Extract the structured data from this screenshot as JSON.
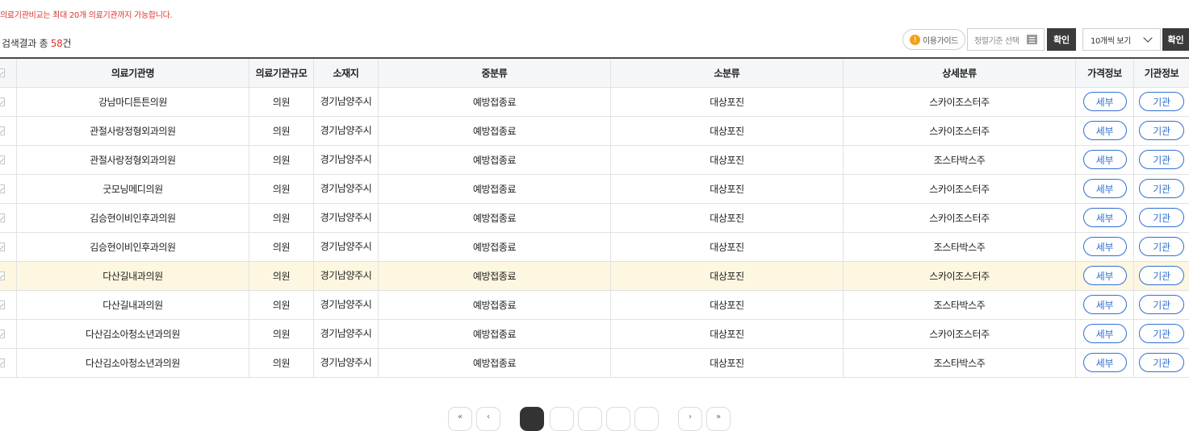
{
  "notice": "의료기관비교는 최대 20개 의료기관까지 가능합니다.",
  "summary": {
    "prefix": "검색결과 총 ",
    "count": "58",
    "suffix": "건"
  },
  "toolbar": {
    "guide_icon": "!",
    "guide_label": "이용가이드",
    "sort_placeholder": "정렬기준 선택",
    "confirm_label": "확인",
    "per_page_value": "10개씩 보기",
    "confirm2_label": "확인"
  },
  "table": {
    "headers": {
      "name": "의료기관명",
      "scale": "의료기관규모",
      "location": "소재지",
      "mid_category": "중분류",
      "sub_category": "소분류",
      "detail_category": "상세분류",
      "price_info": "가격정보",
      "org_info": "기관정보"
    },
    "detail_btn": "세부",
    "org_btn": "기관",
    "rows": [
      {
        "name": "강남마디튼튼의원",
        "scale": "의원",
        "location": "경기남양주시",
        "mid": "예방접종료",
        "sub": "대상포진",
        "detail": "스카이조스터주"
      },
      {
        "name": "관절사랑정형외과의원",
        "scale": "의원",
        "location": "경기남양주시",
        "mid": "예방접종료",
        "sub": "대상포진",
        "detail": "스카이조스터주"
      },
      {
        "name": "관절사랑정형외과의원",
        "scale": "의원",
        "location": "경기남양주시",
        "mid": "예방접종료",
        "sub": "대상포진",
        "detail": "조스타박스주"
      },
      {
        "name": "굿모닝메디의원",
        "scale": "의원",
        "location": "경기남양주시",
        "mid": "예방접종료",
        "sub": "대상포진",
        "detail": "스카이조스터주"
      },
      {
        "name": "김승현이비인후과의원",
        "scale": "의원",
        "location": "경기남양주시",
        "mid": "예방접종료",
        "sub": "대상포진",
        "detail": "스카이조스터주"
      },
      {
        "name": "김승현이비인후과의원",
        "scale": "의원",
        "location": "경기남양주시",
        "mid": "예방접종료",
        "sub": "대상포진",
        "detail": "조스타박스주"
      },
      {
        "name": "다산길내과의원",
        "scale": "의원",
        "location": "경기남양주시",
        "mid": "예방접종료",
        "sub": "대상포진",
        "detail": "스카이조스터주",
        "highlighted": true
      },
      {
        "name": "다산길내과의원",
        "scale": "의원",
        "location": "경기남양주시",
        "mid": "예방접종료",
        "sub": "대상포진",
        "detail": "조스타박스주"
      },
      {
        "name": "다산김소아청소년과의원",
        "scale": "의원",
        "location": "경기남양주시",
        "mid": "예방접종료",
        "sub": "대상포진",
        "detail": "스카이조스터주"
      },
      {
        "name": "다산김소아청소년과의원",
        "scale": "의원",
        "location": "경기남양주시",
        "mid": "예방접종료",
        "sub": "대상포진",
        "detail": "조스타박스주"
      }
    ]
  },
  "pagination": {
    "first_label": "«",
    "prev_label": "‹",
    "next_label": "›",
    "last_label": "»",
    "current_page_index": 0,
    "page_buttons_visible": 5
  }
}
